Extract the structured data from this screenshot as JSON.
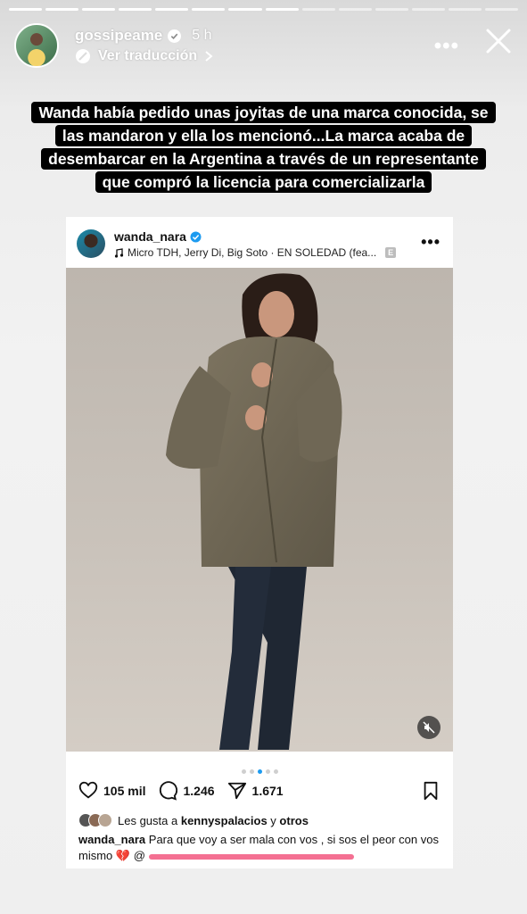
{
  "story": {
    "username": "gossipeame",
    "time": "5 h",
    "translate_label": "Ver traducción",
    "progress_segments": 14,
    "progress_done": 8
  },
  "caption": [
    "Wanda había pedido unas joyitas de una marca conocida, se",
    "las mandaron y ella los mencionó...La marca acaba de",
    "desembarcar en la Argentina a través de un representante",
    "que compró la licencia para comercializarla"
  ],
  "post": {
    "username": "wanda_nara",
    "music": "Micro TDH, Jerry Di, Big Soto · EN SOLEDAD (fea...",
    "explicit": "E",
    "likes": "105 mil",
    "comments": "1.246",
    "shares": "1.671",
    "liked_by_prefix": "Les gusta a",
    "liked_by_user": "kennyspalacios",
    "liked_by_suffix": "y",
    "liked_by_others": "otros",
    "caption_user": "wanda_nara",
    "caption_text": "Para que voy a ser mala con vos , si sos el peor con vos mismo",
    "caption_emoji": "💔",
    "caption_mention": "@",
    "carousel_dots": 5,
    "carousel_active": 2
  },
  "colors": {
    "caption_bg": "#000000",
    "accent_blue": "#1d9bf0",
    "redaction": "#f2577f"
  }
}
